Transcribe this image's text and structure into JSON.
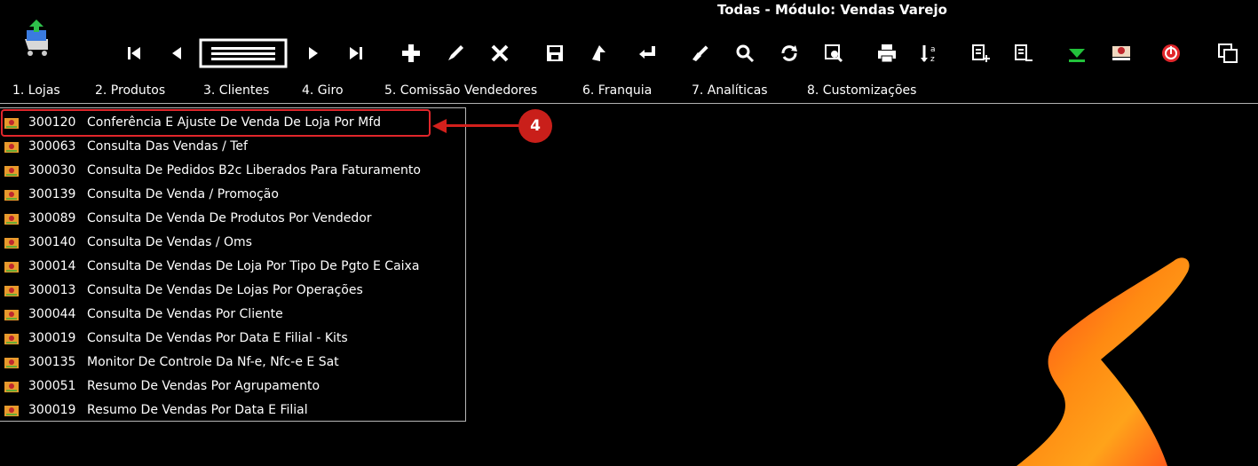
{
  "window": {
    "title": "Todas - Módulo: Vendas Varejo"
  },
  "toolbar": {
    "buttons": [
      {
        "name": "first-record-icon"
      },
      {
        "name": "previous-record-icon"
      },
      {
        "name": "list-view-icon"
      },
      {
        "name": "next-record-icon"
      },
      {
        "name": "last-record-icon"
      },
      {
        "name": "add-icon"
      },
      {
        "name": "edit-pencil-icon"
      },
      {
        "name": "delete-x-icon"
      },
      {
        "name": "save-disk-icon"
      },
      {
        "name": "duplicate-icon"
      },
      {
        "name": "confirm-check-icon"
      },
      {
        "name": "clear-brush-icon"
      },
      {
        "name": "search-icon"
      },
      {
        "name": "refresh-icon"
      },
      {
        "name": "preview-icon"
      },
      {
        "name": "print-icon"
      },
      {
        "name": "sort-az-icon"
      },
      {
        "name": "add-document-icon"
      },
      {
        "name": "remove-document-icon"
      },
      {
        "name": "download-arrow-icon"
      },
      {
        "name": "flag-icon"
      },
      {
        "name": "power-exit-icon"
      },
      {
        "name": "switch-window-icon"
      }
    ]
  },
  "menu": [
    {
      "label": "1. Lojas"
    },
    {
      "label": "2. Produtos"
    },
    {
      "label": "3. Clientes"
    },
    {
      "label": "4. Giro"
    },
    {
      "label": "5. Comissão Vendedores"
    },
    {
      "label": "6. Franquia"
    },
    {
      "label": "7. Analíticas"
    },
    {
      "label": "8. Customizações"
    }
  ],
  "list": {
    "items": [
      {
        "code": "300120",
        "name": "Conferência E Ajuste De Venda De Loja Por Mfd"
      },
      {
        "code": "300063",
        "name": "Consulta Das Vendas / Tef"
      },
      {
        "code": "300030",
        "name": "Consulta De Pedidos B2c Liberados Para Faturamento"
      },
      {
        "code": "300139",
        "name": "Consulta De Venda / Promoção"
      },
      {
        "code": "300089",
        "name": "Consulta De Venda De Produtos Por Vendedor"
      },
      {
        "code": "300140",
        "name": "Consulta De Vendas / Oms"
      },
      {
        "code": "300014",
        "name": "Consulta De Vendas De Loja Por Tipo De Pgto E Caixa"
      },
      {
        "code": "300013",
        "name": "Consulta De Vendas De Lojas Por Operações"
      },
      {
        "code": "300044",
        "name": "Consulta De Vendas Por Cliente"
      },
      {
        "code": "300019",
        "name": "Consulta De Vendas Por Data E Filial - Kits"
      },
      {
        "code": "300135",
        "name": "Monitor De Controle Da Nf-e, Nfc-e E Sat"
      },
      {
        "code": "300051",
        "name": "Resumo De Vendas Por Agrupamento"
      },
      {
        "code": "300019",
        "name": "Resumo De Vendas Por Data E Filial"
      }
    ]
  },
  "annotation": {
    "step": "4"
  },
  "colors": {
    "highlight": "#e1262b",
    "background": "#000000",
    "text": "#ffffff"
  }
}
